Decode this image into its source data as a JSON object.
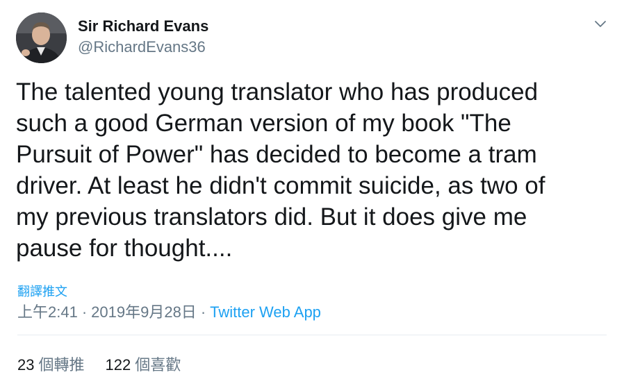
{
  "author": {
    "display_name": "Sir Richard Evans",
    "handle": "@RichardEvans36",
    "avatar_icon": "profile-photo"
  },
  "tweet": {
    "text": "The talented young translator who has produced\nsuch a good German version of my book \"The\nPursuit of Power\" has decided to become a tram\ndriver. At least he didn't commit suicide, as two of\nmy previous translators did. But it does give me\npause for thought....",
    "translate_label": "翻譯推文"
  },
  "meta": {
    "time": "上午2:41",
    "separator": "·",
    "date": "2019年9月28日",
    "source": "Twitter Web App"
  },
  "stats": {
    "retweets_count": "23",
    "retweets_label": "個轉推",
    "likes_count": "122",
    "likes_label": "個喜歡"
  },
  "colors": {
    "text": "#14171a",
    "secondary": "#657786",
    "link": "#1da1f2",
    "divider": "#e6ecf0"
  }
}
